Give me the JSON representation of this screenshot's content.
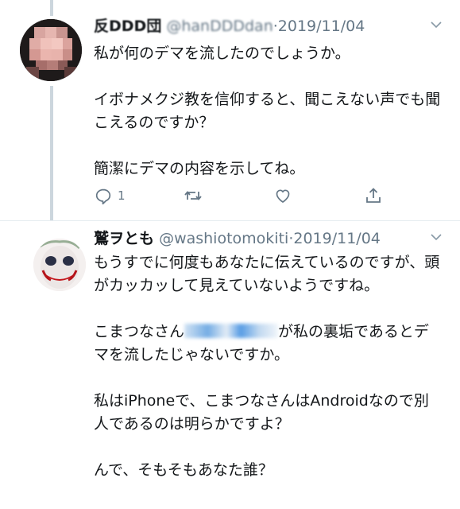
{
  "tweets": [
    {
      "display_name": "反DDD団",
      "handle": "@hanDDDdan",
      "separator": "·",
      "date": "2019/11/04",
      "body": "私が何のデマを流したのでしょうか。\n\nイボナメクジ教を信仰すると、聞こえない声でも聞こえるのですか？\n\n簡潔にデマの内容を示してね。",
      "reply_count": "1"
    },
    {
      "display_name": "鷲ヲとも",
      "handle": "@washiotomokiti",
      "separator": "·",
      "date": "2019/11/04",
      "body_part1": "もうすでに何度もあなたに伝えているのですが、頭がカッカッして見えていないようですね。\n\nこまつなさん",
      "body_part2": "が私の裏垢であるとデマを流したじゃないですか。\n\n私はiPhoneで、こまつなさんはAndroidなので別人であるのは明らかですよ？\n\nんで、そもそもあなた誰？"
    }
  ],
  "icons": [
    "chevron-down-icon",
    "reply-icon",
    "retweet-icon",
    "like-icon",
    "share-icon"
  ],
  "colors": {
    "text": "#14171a",
    "muted": "#657786",
    "thread_line": "#ccd6dd",
    "mention": "#1da1f2"
  }
}
